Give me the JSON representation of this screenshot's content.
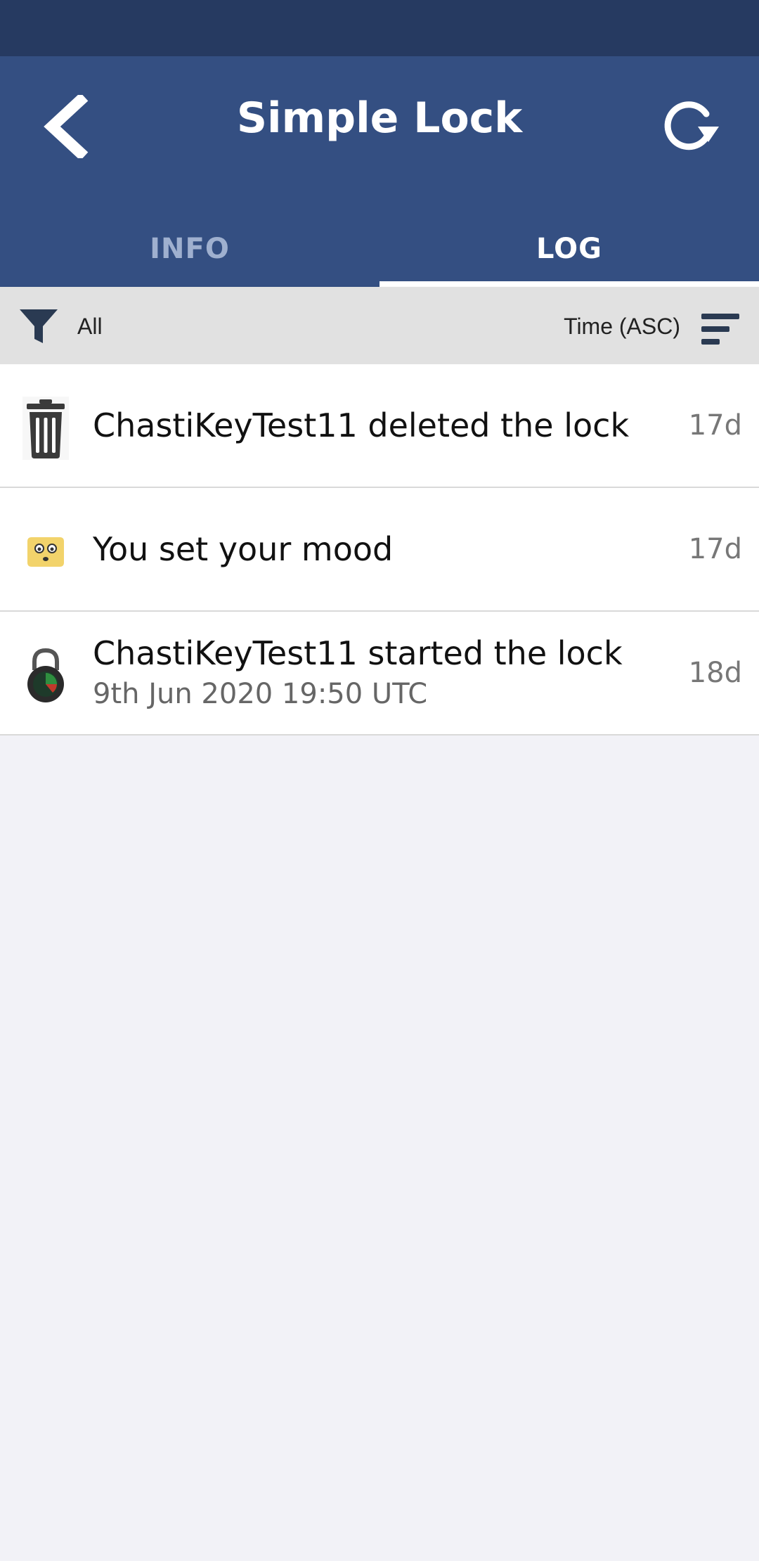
{
  "header": {
    "title": "Simple Lock",
    "back_icon": "chevron-left-icon",
    "refresh_icon": "refresh-icon",
    "background": "#344f82",
    "status_bar_color": "#263a61"
  },
  "tabs": [
    {
      "label": "INFO",
      "active": false
    },
    {
      "label": "LOG",
      "active": true
    }
  ],
  "filter_bar": {
    "filter_label": "All",
    "filter_icon": "filter-icon",
    "sort_label": "Time (ASC)",
    "sort_icon": "sort-icon"
  },
  "log": {
    "items": [
      {
        "icon": "trash-icon",
        "title": "ChastiKeyTest11 deleted the lock",
        "subtitle": "",
        "time": "17d"
      },
      {
        "icon": "mood-face-icon",
        "title": "You set your mood",
        "subtitle": "",
        "time": "17d"
      },
      {
        "icon": "padlock-icon",
        "title": "ChastiKeyTest11 started the lock",
        "subtitle": "9th Jun 2020 19:50 UTC",
        "time": "18d"
      }
    ]
  }
}
